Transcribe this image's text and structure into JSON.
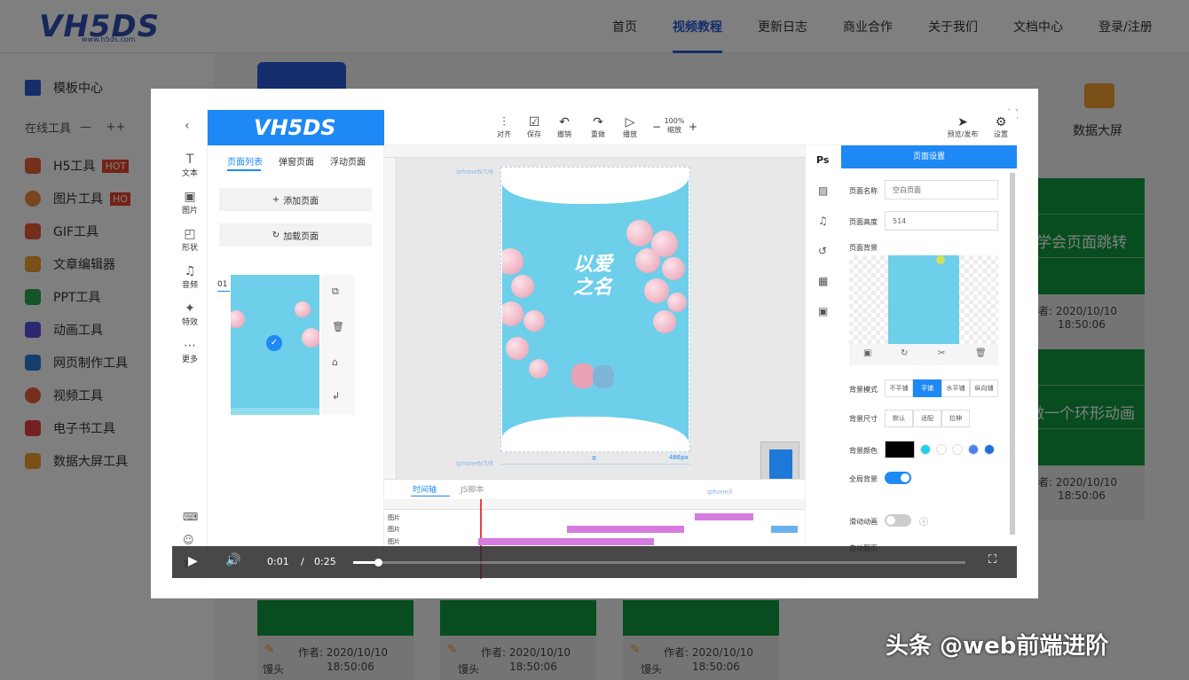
{
  "site": {
    "logo_text": "VH5DS",
    "logo_sub": "www.h5ds.com",
    "nav": [
      "首页",
      "视频教程",
      "更新日志",
      "商业合作",
      "关于我们",
      "文档中心",
      "登录/注册"
    ]
  },
  "sidebar": {
    "template_center": "模板中心",
    "online_tools": "在线工具",
    "items": [
      {
        "label": "H5工具",
        "hot": "HOT",
        "color": "#e8613a"
      },
      {
        "label": "图片工具",
        "hot": "HO",
        "color": "#f08a3c"
      },
      {
        "label": "GIF工具",
        "color": "#e85a3a"
      },
      {
        "label": "文章编辑器",
        "color": "#f0a030"
      },
      {
        "label": "PPT工具",
        "color": "#2aa84a"
      },
      {
        "label": "动画工具",
        "color": "#5a4fe0"
      },
      {
        "label": "网页制作工具",
        "color": "#2e7ad8"
      },
      {
        "label": "视频工具",
        "color": "#e8613a"
      },
      {
        "label": "电子书工具",
        "color": "#e84040"
      },
      {
        "label": "数据大屏工具",
        "color": "#f0a030"
      }
    ]
  },
  "background": {
    "data_screen_label": "数据大屏",
    "card1_title": "学会页面跳转",
    "card2_title": "做一个环形动画",
    "author_date": "者: 2020/10/10",
    "time": "18:50:06",
    "bottom_author": "作者: 2020/10/10",
    "bottom_name": "馒头"
  },
  "editor": {
    "brand": "VH5DS",
    "left_tools": [
      "文本",
      "图片",
      "形状",
      "音频",
      "特效",
      "更多"
    ],
    "tabs": [
      "页面列表",
      "弹窗页面",
      "浮动页面"
    ],
    "add_page": "添加页面",
    "load_page": "加载页面",
    "page_number": "01",
    "top_tools": [
      "对齐",
      "保存",
      "撤销",
      "重做",
      "播放"
    ],
    "zoom_value": "100%",
    "zoom_label": "缩放",
    "publish": "预览/发布",
    "settings": "设置",
    "device_label": "iphone6/7/8",
    "height_px": "486px",
    "timeline_tab": "时间轴",
    "js_tab": "JS脚本",
    "timeline_device": "iphoneX",
    "layer_label": "图片",
    "poster_title_cn": "以爱之名",
    "ps_label": "Ps"
  },
  "right_panel": {
    "title": "页面设置",
    "page_name_label": "页面名称",
    "page_name_value": "空白页面",
    "page_height_label": "页面高度",
    "page_height_value": "514",
    "page_bg_label": "页面背景",
    "bg_mode_label": "背景模式",
    "bg_modes": [
      "不平铺",
      "平铺",
      "水平铺",
      "纵向铺"
    ],
    "bg_size_label": "背景尺寸",
    "bg_sizes": [
      "默认",
      "适配",
      "拉伸"
    ],
    "bg_color_label": "背景颜色",
    "full_bg_label": "全局背景",
    "slide_anim_label": "滑动动画",
    "auto_flip_label": "自动翻页"
  },
  "video": {
    "current": "0:01",
    "separator": "/",
    "total": "0:25",
    "progress": 0.04
  },
  "watermark": "头条 @web前端进阶"
}
